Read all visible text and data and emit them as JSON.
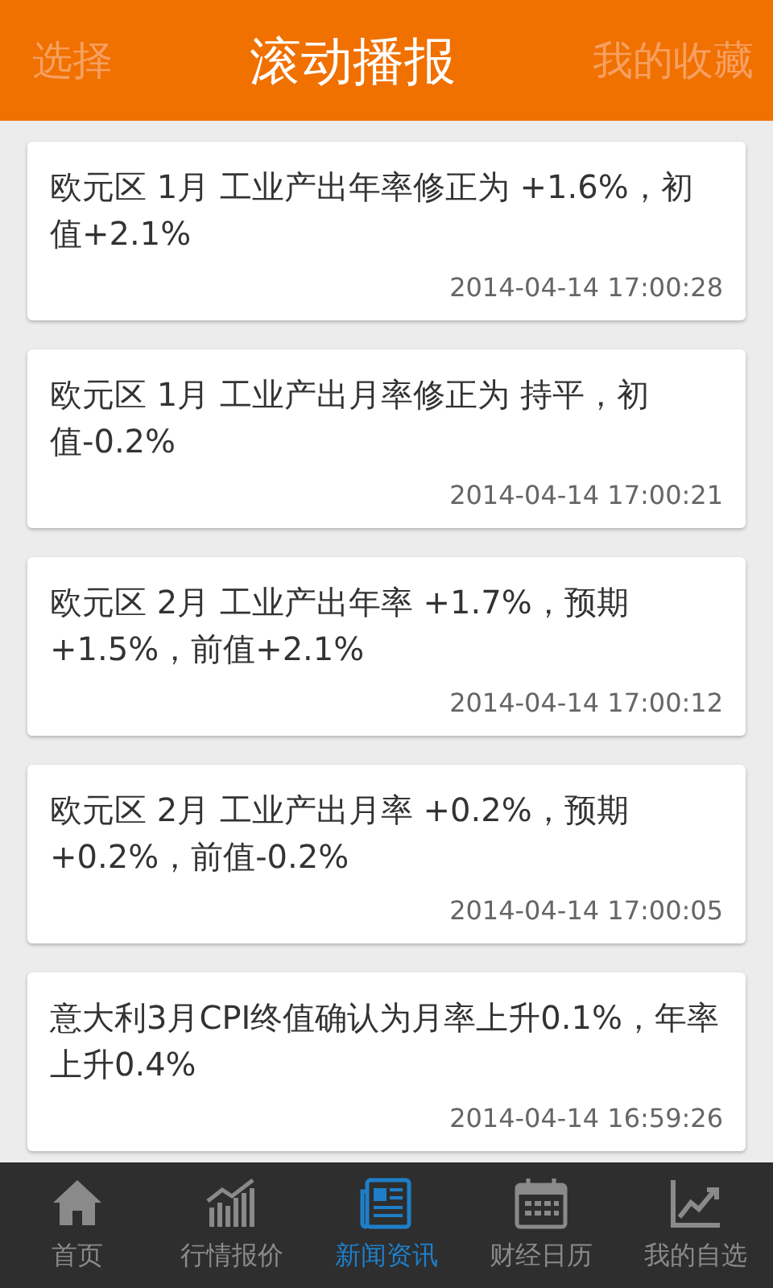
{
  "header": {
    "left_button": "选择",
    "title": "滚动播报",
    "right_button": "我的收藏"
  },
  "news": [
    {
      "text": "欧元区 1月 工业产出年率修正为 +1.6%，初值+2.1%",
      "time": "2014-04-14 17:00:28"
    },
    {
      "text": "欧元区 1月 工业产出月率修正为 持平，初值-0.2%",
      "time": "2014-04-14 17:00:21"
    },
    {
      "text": "欧元区 2月 工业产出年率 +1.7%，预期+1.5%，前值+2.1%",
      "time": "2014-04-14 17:00:12"
    },
    {
      "text": "欧元区 2月 工业产出月率 +0.2%，预期+0.2%，前值-0.2%",
      "time": "2014-04-14 17:00:05"
    },
    {
      "text": "意大利3月CPI终值确认为月率上升0.1%，年率上升0.4%",
      "time": "2014-04-14 16:59:26"
    }
  ],
  "tabs": [
    {
      "label": "首页",
      "kind": "home",
      "selected": false
    },
    {
      "label": "行情报价",
      "kind": "quotes",
      "selected": false
    },
    {
      "label": "新闻资讯",
      "kind": "news",
      "selected": true
    },
    {
      "label": "财经日历",
      "kind": "calendar",
      "selected": false
    },
    {
      "label": "我的自选",
      "kind": "watchlist",
      "selected": false
    }
  ]
}
